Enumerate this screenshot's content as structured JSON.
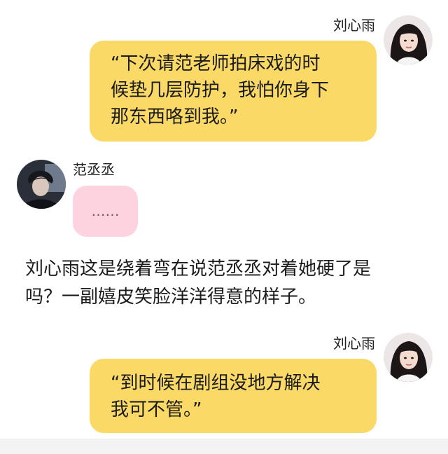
{
  "messages": [
    {
      "sender": "刘心雨",
      "text": "“下次请范老师拍床戏的时\n候垫几层防护，我怕你身下\n那东西咯到我。”",
      "side": "right",
      "bubble_color": "#fbd966"
    },
    {
      "sender": "范丞丞",
      "text": "……",
      "side": "left",
      "bubble_color": "#fcd3df"
    },
    {
      "sender": "刘心雨",
      "text": "“到时候在剧组没地方解决\n我可不管。”",
      "side": "right",
      "bubble_color": "#fbd966"
    }
  ],
  "narration": "刘心雨这是绕着弯在说范丞丞对着她硬了是\n吗？一副嬉皮笑脸洋洋得意的样子。",
  "avatars": {
    "female": "female-avatar-icon",
    "male": "male-avatar-icon"
  }
}
